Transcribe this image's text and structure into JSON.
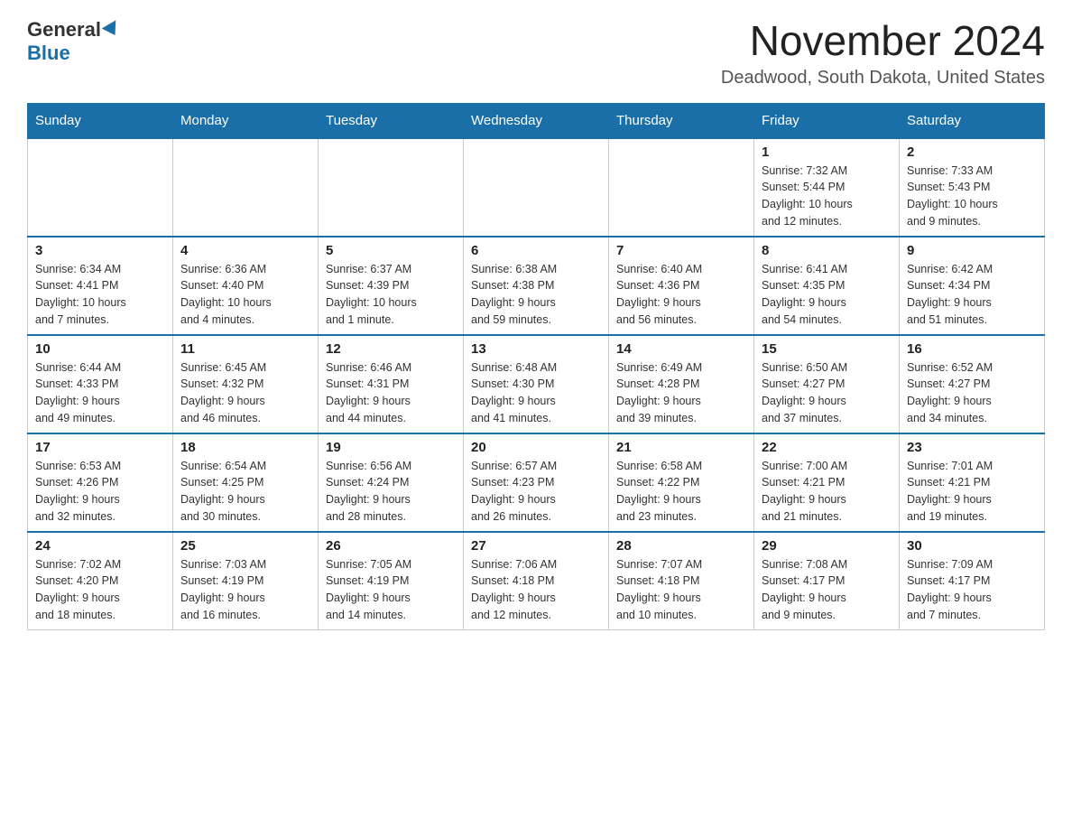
{
  "logo": {
    "general": "General",
    "blue": "Blue"
  },
  "title": "November 2024",
  "subtitle": "Deadwood, South Dakota, United States",
  "days_of_week": [
    "Sunday",
    "Monday",
    "Tuesday",
    "Wednesday",
    "Thursday",
    "Friday",
    "Saturday"
  ],
  "weeks": [
    [
      {
        "day": "",
        "info": ""
      },
      {
        "day": "",
        "info": ""
      },
      {
        "day": "",
        "info": ""
      },
      {
        "day": "",
        "info": ""
      },
      {
        "day": "",
        "info": ""
      },
      {
        "day": "1",
        "info": "Sunrise: 7:32 AM\nSunset: 5:44 PM\nDaylight: 10 hours\nand 12 minutes."
      },
      {
        "day": "2",
        "info": "Sunrise: 7:33 AM\nSunset: 5:43 PM\nDaylight: 10 hours\nand 9 minutes."
      }
    ],
    [
      {
        "day": "3",
        "info": "Sunrise: 6:34 AM\nSunset: 4:41 PM\nDaylight: 10 hours\nand 7 minutes."
      },
      {
        "day": "4",
        "info": "Sunrise: 6:36 AM\nSunset: 4:40 PM\nDaylight: 10 hours\nand 4 minutes."
      },
      {
        "day": "5",
        "info": "Sunrise: 6:37 AM\nSunset: 4:39 PM\nDaylight: 10 hours\nand 1 minute."
      },
      {
        "day": "6",
        "info": "Sunrise: 6:38 AM\nSunset: 4:38 PM\nDaylight: 9 hours\nand 59 minutes."
      },
      {
        "day": "7",
        "info": "Sunrise: 6:40 AM\nSunset: 4:36 PM\nDaylight: 9 hours\nand 56 minutes."
      },
      {
        "day": "8",
        "info": "Sunrise: 6:41 AM\nSunset: 4:35 PM\nDaylight: 9 hours\nand 54 minutes."
      },
      {
        "day": "9",
        "info": "Sunrise: 6:42 AM\nSunset: 4:34 PM\nDaylight: 9 hours\nand 51 minutes."
      }
    ],
    [
      {
        "day": "10",
        "info": "Sunrise: 6:44 AM\nSunset: 4:33 PM\nDaylight: 9 hours\nand 49 minutes."
      },
      {
        "day": "11",
        "info": "Sunrise: 6:45 AM\nSunset: 4:32 PM\nDaylight: 9 hours\nand 46 minutes."
      },
      {
        "day": "12",
        "info": "Sunrise: 6:46 AM\nSunset: 4:31 PM\nDaylight: 9 hours\nand 44 minutes."
      },
      {
        "day": "13",
        "info": "Sunrise: 6:48 AM\nSunset: 4:30 PM\nDaylight: 9 hours\nand 41 minutes."
      },
      {
        "day": "14",
        "info": "Sunrise: 6:49 AM\nSunset: 4:28 PM\nDaylight: 9 hours\nand 39 minutes."
      },
      {
        "day": "15",
        "info": "Sunrise: 6:50 AM\nSunset: 4:27 PM\nDaylight: 9 hours\nand 37 minutes."
      },
      {
        "day": "16",
        "info": "Sunrise: 6:52 AM\nSunset: 4:27 PM\nDaylight: 9 hours\nand 34 minutes."
      }
    ],
    [
      {
        "day": "17",
        "info": "Sunrise: 6:53 AM\nSunset: 4:26 PM\nDaylight: 9 hours\nand 32 minutes."
      },
      {
        "day": "18",
        "info": "Sunrise: 6:54 AM\nSunset: 4:25 PM\nDaylight: 9 hours\nand 30 minutes."
      },
      {
        "day": "19",
        "info": "Sunrise: 6:56 AM\nSunset: 4:24 PM\nDaylight: 9 hours\nand 28 minutes."
      },
      {
        "day": "20",
        "info": "Sunrise: 6:57 AM\nSunset: 4:23 PM\nDaylight: 9 hours\nand 26 minutes."
      },
      {
        "day": "21",
        "info": "Sunrise: 6:58 AM\nSunset: 4:22 PM\nDaylight: 9 hours\nand 23 minutes."
      },
      {
        "day": "22",
        "info": "Sunrise: 7:00 AM\nSunset: 4:21 PM\nDaylight: 9 hours\nand 21 minutes."
      },
      {
        "day": "23",
        "info": "Sunrise: 7:01 AM\nSunset: 4:21 PM\nDaylight: 9 hours\nand 19 minutes."
      }
    ],
    [
      {
        "day": "24",
        "info": "Sunrise: 7:02 AM\nSunset: 4:20 PM\nDaylight: 9 hours\nand 18 minutes."
      },
      {
        "day": "25",
        "info": "Sunrise: 7:03 AM\nSunset: 4:19 PM\nDaylight: 9 hours\nand 16 minutes."
      },
      {
        "day": "26",
        "info": "Sunrise: 7:05 AM\nSunset: 4:19 PM\nDaylight: 9 hours\nand 14 minutes."
      },
      {
        "day": "27",
        "info": "Sunrise: 7:06 AM\nSunset: 4:18 PM\nDaylight: 9 hours\nand 12 minutes."
      },
      {
        "day": "28",
        "info": "Sunrise: 7:07 AM\nSunset: 4:18 PM\nDaylight: 9 hours\nand 10 minutes."
      },
      {
        "day": "29",
        "info": "Sunrise: 7:08 AM\nSunset: 4:17 PM\nDaylight: 9 hours\nand 9 minutes."
      },
      {
        "day": "30",
        "info": "Sunrise: 7:09 AM\nSunset: 4:17 PM\nDaylight: 9 hours\nand 7 minutes."
      }
    ]
  ]
}
